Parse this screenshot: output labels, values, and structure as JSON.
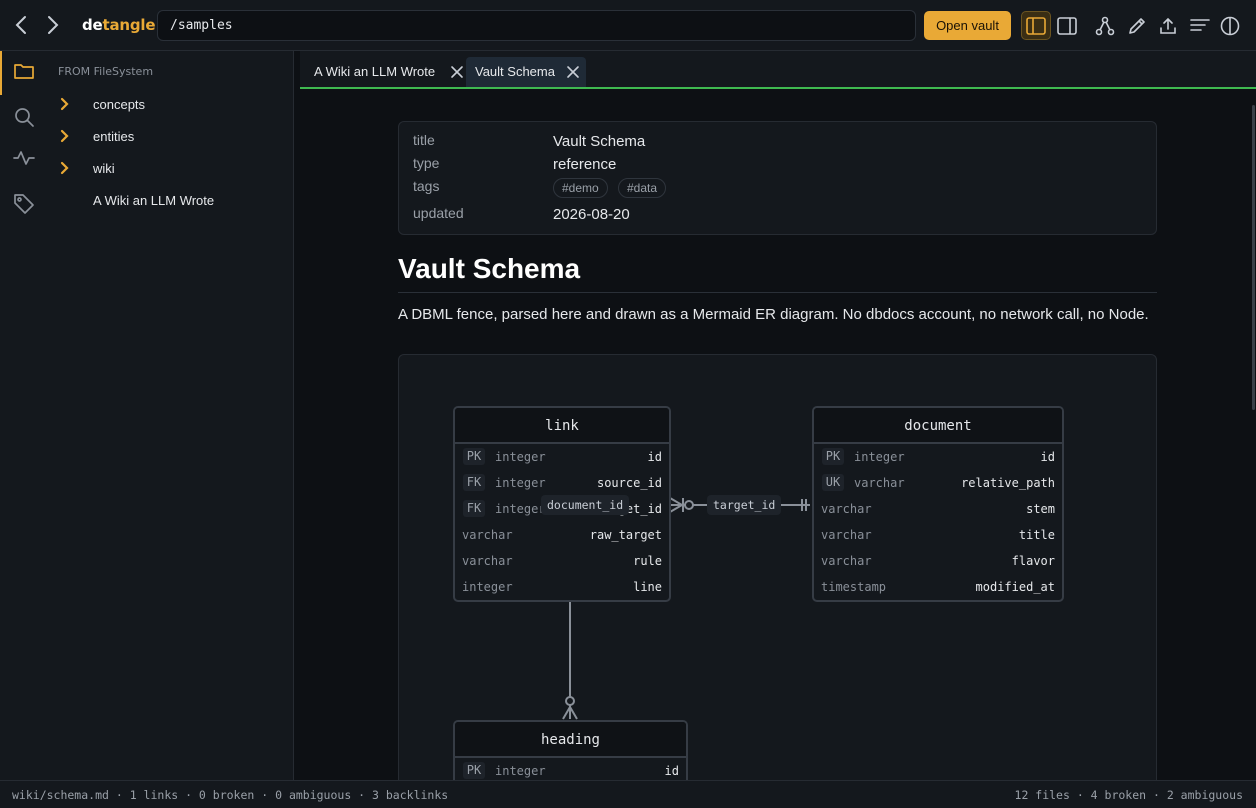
{
  "app": {
    "brand_prefix": "de",
    "brand_suffix": "tangle"
  },
  "address": {
    "value": "/samples"
  },
  "toolbar": {
    "open_vault_label": "Open vault",
    "icons": [
      "sidebar-left-icon",
      "sidebar-right-icon",
      "graph-icon",
      "pencil-icon",
      "upload-icon",
      "outline-icon",
      "theme-icon"
    ]
  },
  "colors": {
    "accent": "#e9a936",
    "tab_underline": "#3fb950",
    "background": "#0d1014",
    "panel": "#14181d"
  },
  "activity": {
    "icons": [
      "folder-icon",
      "search-icon",
      "pulse-icon",
      "tag-icon"
    ]
  },
  "explorer": {
    "title": "FROM FileSystem",
    "items": [
      {
        "label": "concepts",
        "folder": true
      },
      {
        "label": "entities",
        "folder": true
      },
      {
        "label": "wiki",
        "folder": true
      },
      {
        "label": "A Wiki an LLM Wrote",
        "folder": false
      }
    ]
  },
  "tabs": [
    {
      "label": "A Wiki an LLM Wrote",
      "active": false
    },
    {
      "label": "Vault Schema",
      "active": true
    }
  ],
  "frontmatter": {
    "title_key": "title",
    "title_value": "Vault Schema",
    "type_key": "type",
    "type_value": "reference",
    "tags_key": "tags",
    "tags": [
      "#demo",
      "#data"
    ],
    "updated_key": "updated",
    "updated_value": "2026-08-20"
  },
  "document": {
    "heading": "Vault Schema",
    "paragraph": "A DBML fence, parsed here and drawn as a Mermaid ER diagram. No dbdocs account, no network call, no Node."
  },
  "diagram": {
    "tables": {
      "link": {
        "name": "link",
        "rows": [
          {
            "key": "PK",
            "type": "integer",
            "name": "id"
          },
          {
            "key": "FK",
            "type": "integer",
            "name": "source_id"
          },
          {
            "key": "FK",
            "type": "integer",
            "name": "target_id"
          },
          {
            "key": "",
            "type": "varchar",
            "name": "raw_target"
          },
          {
            "key": "",
            "type": "varchar",
            "name": "rule"
          },
          {
            "key": "",
            "type": "integer",
            "name": "line"
          }
        ]
      },
      "document": {
        "name": "document",
        "rows": [
          {
            "key": "PK",
            "type": "integer",
            "name": "id"
          },
          {
            "key": "UK",
            "type": "varchar",
            "name": "relative_path"
          },
          {
            "key": "",
            "type": "varchar",
            "name": "stem"
          },
          {
            "key": "",
            "type": "varchar",
            "name": "title"
          },
          {
            "key": "",
            "type": "varchar",
            "name": "flavor"
          },
          {
            "key": "",
            "type": "timestamp",
            "name": "modified_at"
          }
        ]
      },
      "heading": {
        "name": "heading",
        "rows": [
          {
            "key": "PK",
            "type": "integer",
            "name": "id"
          }
        ]
      }
    },
    "relations": {
      "document_id": "document_id",
      "target_id": "target_id"
    }
  },
  "status": {
    "left": "wiki/schema.md · 1 links · 0 broken · 0 ambiguous · 3 backlinks",
    "right": "12 files · 4 broken · 2 ambiguous"
  }
}
